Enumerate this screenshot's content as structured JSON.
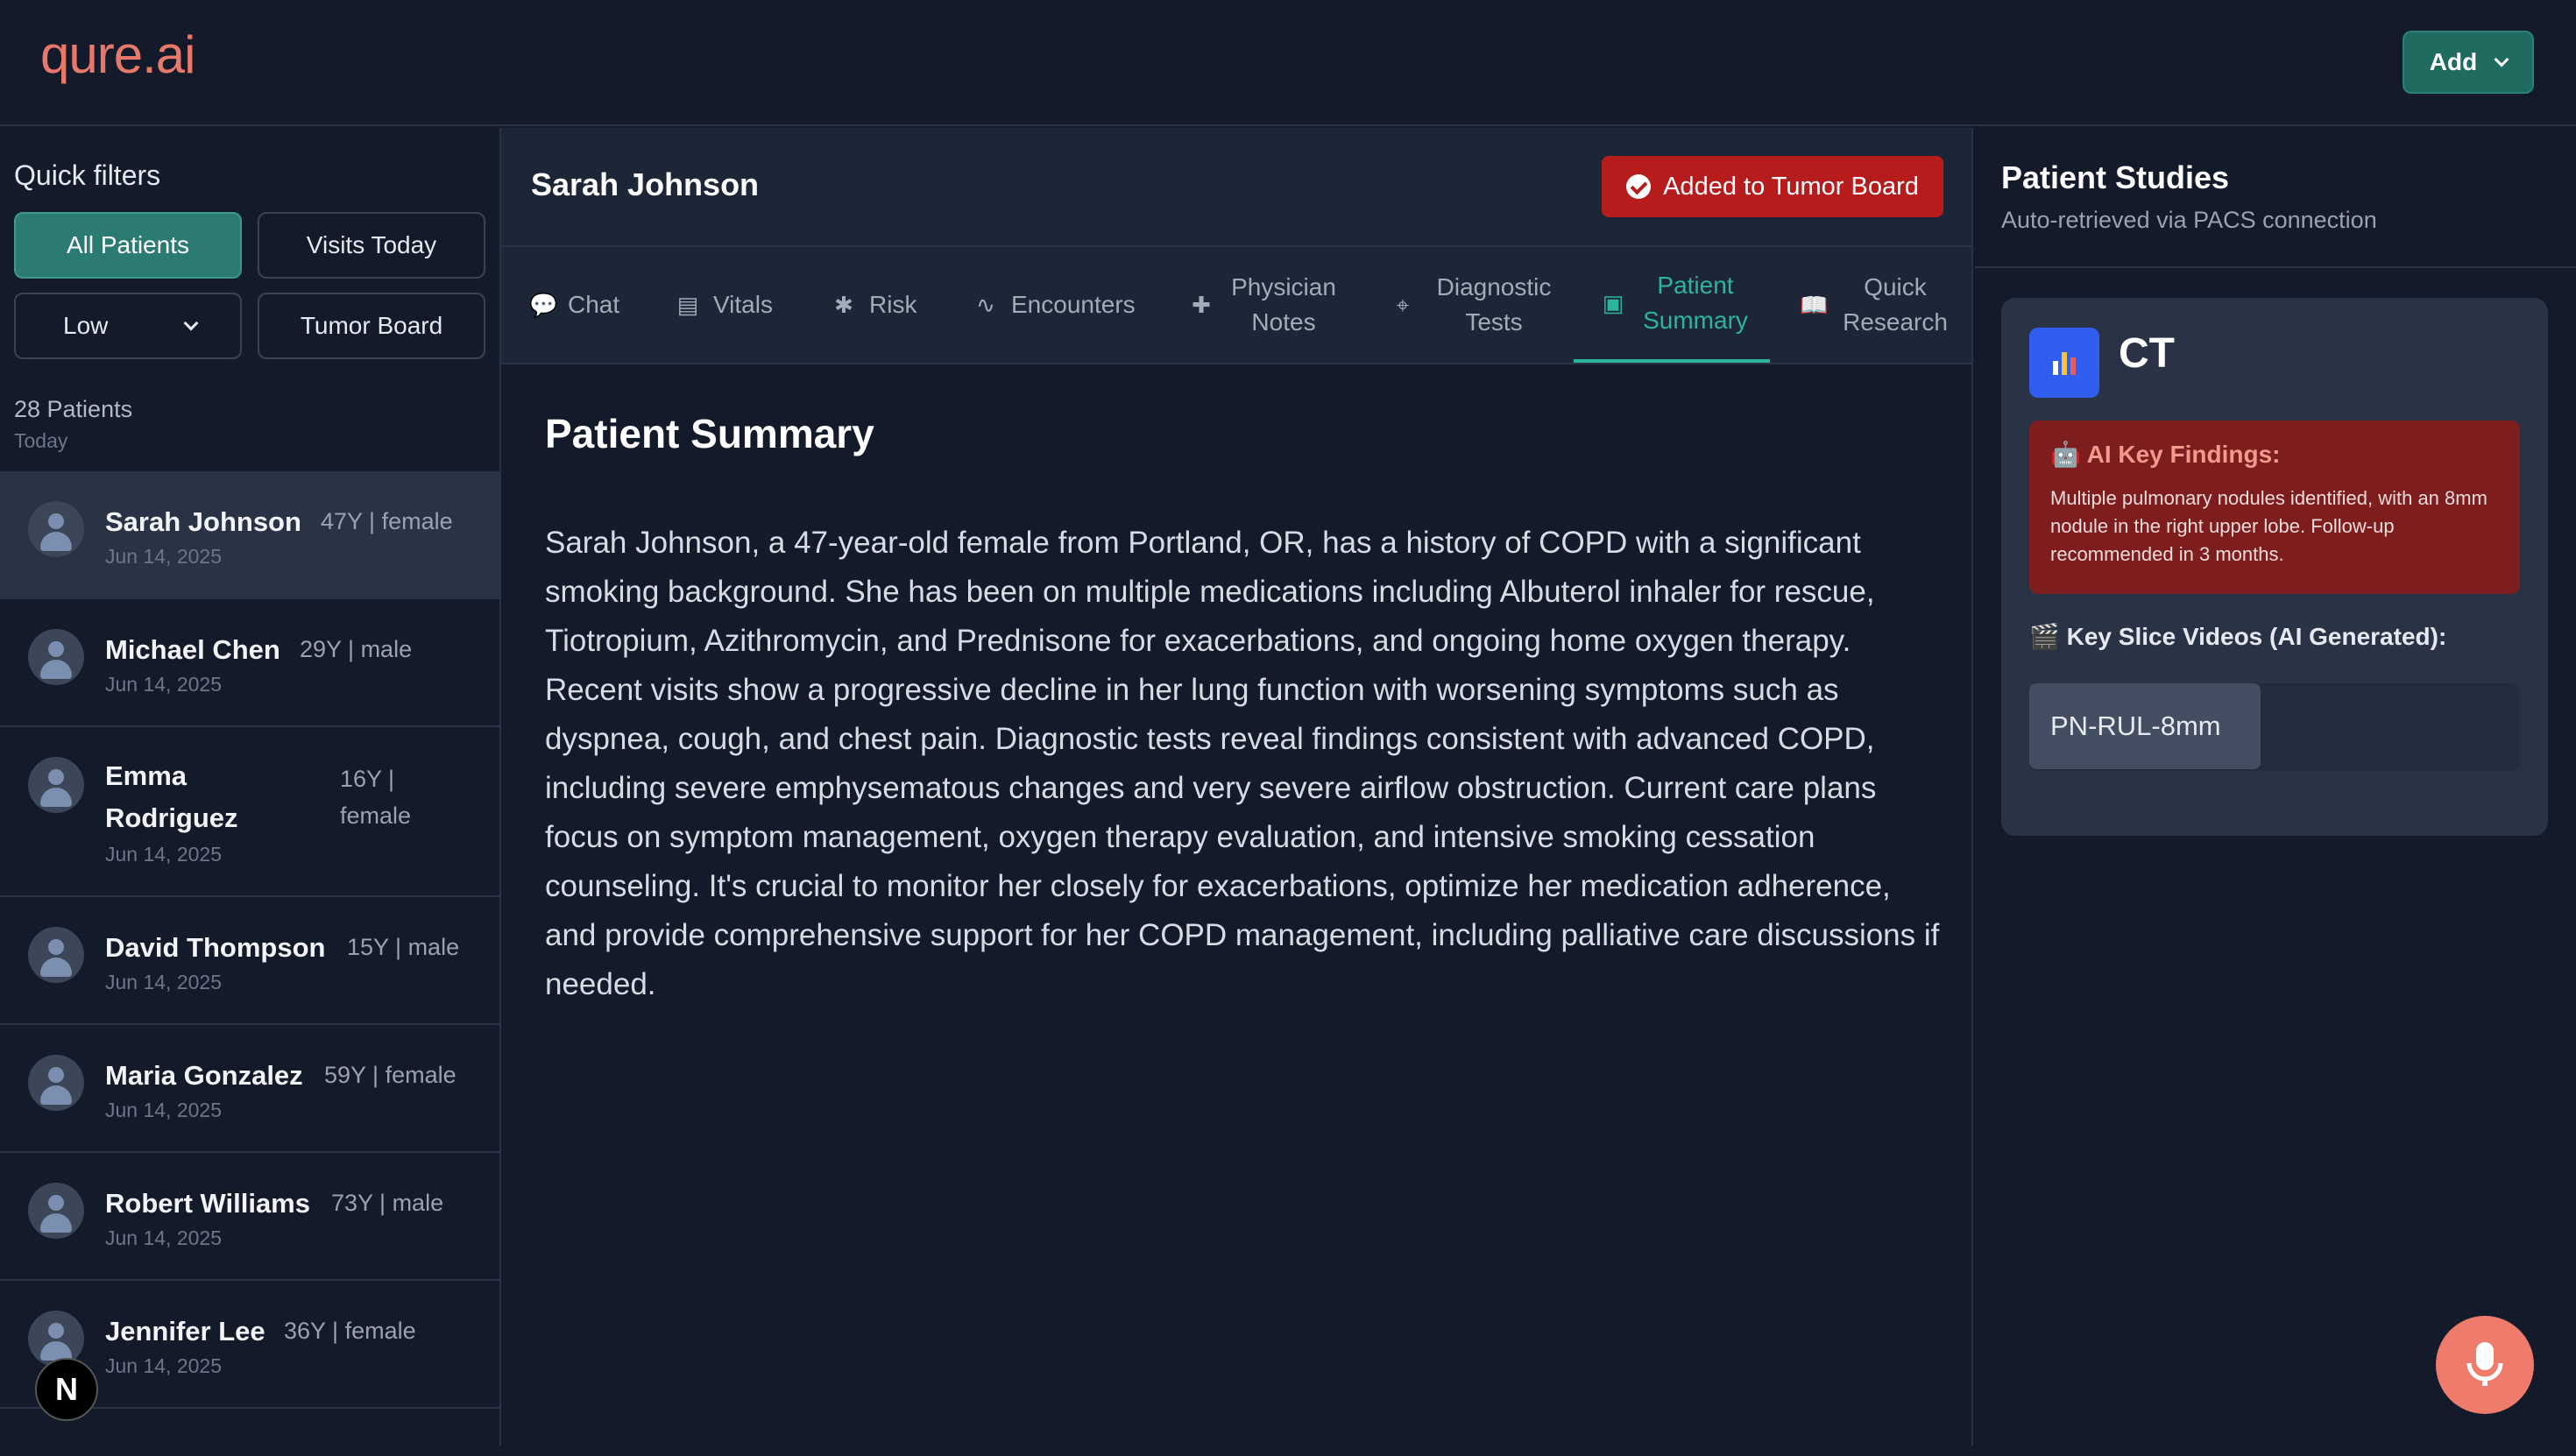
{
  "header": {
    "logo": "qure.ai",
    "add_label": "Add"
  },
  "sidebar": {
    "quick_filters_title": "Quick filters",
    "filters": {
      "all_patients": "All Patients",
      "visits_today": "Visits Today",
      "risk_select": "Low",
      "tumor_board": "Tumor Board"
    },
    "patient_count": "28 Patients",
    "patient_count_sub": "Today",
    "patients": [
      {
        "name": "Sarah Johnson",
        "meta": "47Y | female",
        "date": "Jun 14, 2025"
      },
      {
        "name": "Michael Chen",
        "meta": "29Y | male",
        "date": "Jun 14, 2025"
      },
      {
        "name": "Emma Rodriguez",
        "meta": "16Y | female",
        "date": "Jun 14, 2025"
      },
      {
        "name": "David Thompson",
        "meta": "15Y | male",
        "date": "Jun 14, 2025"
      },
      {
        "name": "Maria Gonzalez",
        "meta": "59Y | female",
        "date": "Jun 14, 2025"
      },
      {
        "name": "Robert Williams",
        "meta": "73Y | male",
        "date": "Jun 14, 2025"
      },
      {
        "name": "Jennifer Lee",
        "meta": "36Y | female",
        "date": "Jun 14, 2025"
      }
    ],
    "next_badge": "N"
  },
  "center": {
    "patient_name": "Sarah Johnson",
    "tumor_board_label": "Added to Tumor Board",
    "tabs": [
      {
        "label": "Chat",
        "icon": "chat-icon"
      },
      {
        "label": "Vitals",
        "icon": "clipboard-chart-icon"
      },
      {
        "label": "Risk",
        "icon": "asterisk-icon"
      },
      {
        "label": "Encounters",
        "icon": "pulse-icon"
      },
      {
        "label": "Physician Notes",
        "icon": "medical-clipboard-icon"
      },
      {
        "label": "Diagnostic Tests",
        "icon": "crosshair-icon"
      },
      {
        "label": "Patient Summary",
        "icon": "medical-book-icon"
      },
      {
        "label": "Quick Research",
        "icon": "book-open-icon"
      }
    ],
    "active_tab": "Patient Summary",
    "summary_title": "Patient Summary",
    "summary_text": "Sarah Johnson, a 47-year-old female from Portland, OR, has a history of COPD with a significant smoking background. She has been on multiple medications including Albuterol inhaler for rescue, Tiotropium, Azithromycin, and Prednisone for exacerbations, and ongoing home oxygen therapy. Recent visits show a progressive decline in her lung function with worsening symptoms such as dyspnea, cough, and chest pain. Diagnostic tests reveal findings consistent with advanced COPD, including severe emphysematous changes and very severe airflow obstruction. Current care plans focus on symptom management, oxygen therapy evaluation, and intensive smoking cessation counseling. It's crucial to monitor her closely for exacerbations, optimize her medication adherence, and provide comprehensive support for her COPD management, including palliative care discussions if needed."
  },
  "right": {
    "title": "Patient Studies",
    "subtitle": "Auto-retrieved via PACS connection",
    "study": {
      "modality": "CT",
      "findings_title": "🤖 AI Key Findings:",
      "findings_text": "Multiple pulmonary nodules identified, with an 8mm nodule in the right upper lobe. Follow-up recommended in 3 months.",
      "videos_title": "🎬 Key Slice Videos (AI Generated):",
      "videos": [
        "PN-RUL-8mm"
      ]
    }
  },
  "colors": {
    "accent": "#2bb59f",
    "logo": "#e8796a",
    "danger": "#b71c1c",
    "mic": "#ee7b6c"
  }
}
